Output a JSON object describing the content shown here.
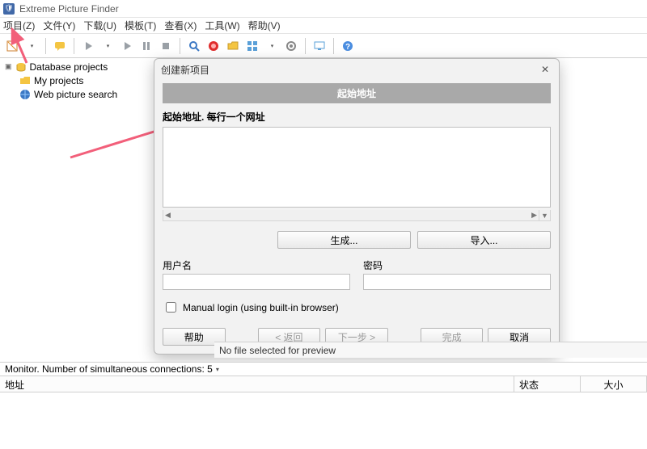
{
  "window": {
    "title": "Extreme Picture Finder"
  },
  "menubar": {
    "items": [
      "项目(Z)",
      "文件(Y)",
      "下载(U)",
      "模板(T)",
      "查看(X)",
      "工具(W)",
      "帮助(V)"
    ]
  },
  "tree": {
    "root": {
      "label": "Database projects"
    },
    "children": [
      {
        "label": "My projects"
      },
      {
        "label": "Web picture search"
      }
    ]
  },
  "preview": {
    "empty": "No file selected for preview"
  },
  "monitor": {
    "text": "Monitor. Number of simultaneous connections: 5",
    "dropdown_glyph": "▾"
  },
  "columns": {
    "addr": "地址",
    "status": "状态",
    "size": "大小"
  },
  "dialog": {
    "title": "创建新项目",
    "close": "✕",
    "banner": "起始地址",
    "textarea_label": "起始地址. 每行一个网址",
    "textarea_value": "",
    "generate": "生成...",
    "import": "导入...",
    "username_label": "用户名",
    "username_value": "",
    "password_label": "密码",
    "password_value": "",
    "manual_login_label": "Manual login (using built-in browser)",
    "help": "帮助",
    "back": "< 返回",
    "next": "下一步 >",
    "finish": "完成",
    "cancel": "取消"
  }
}
